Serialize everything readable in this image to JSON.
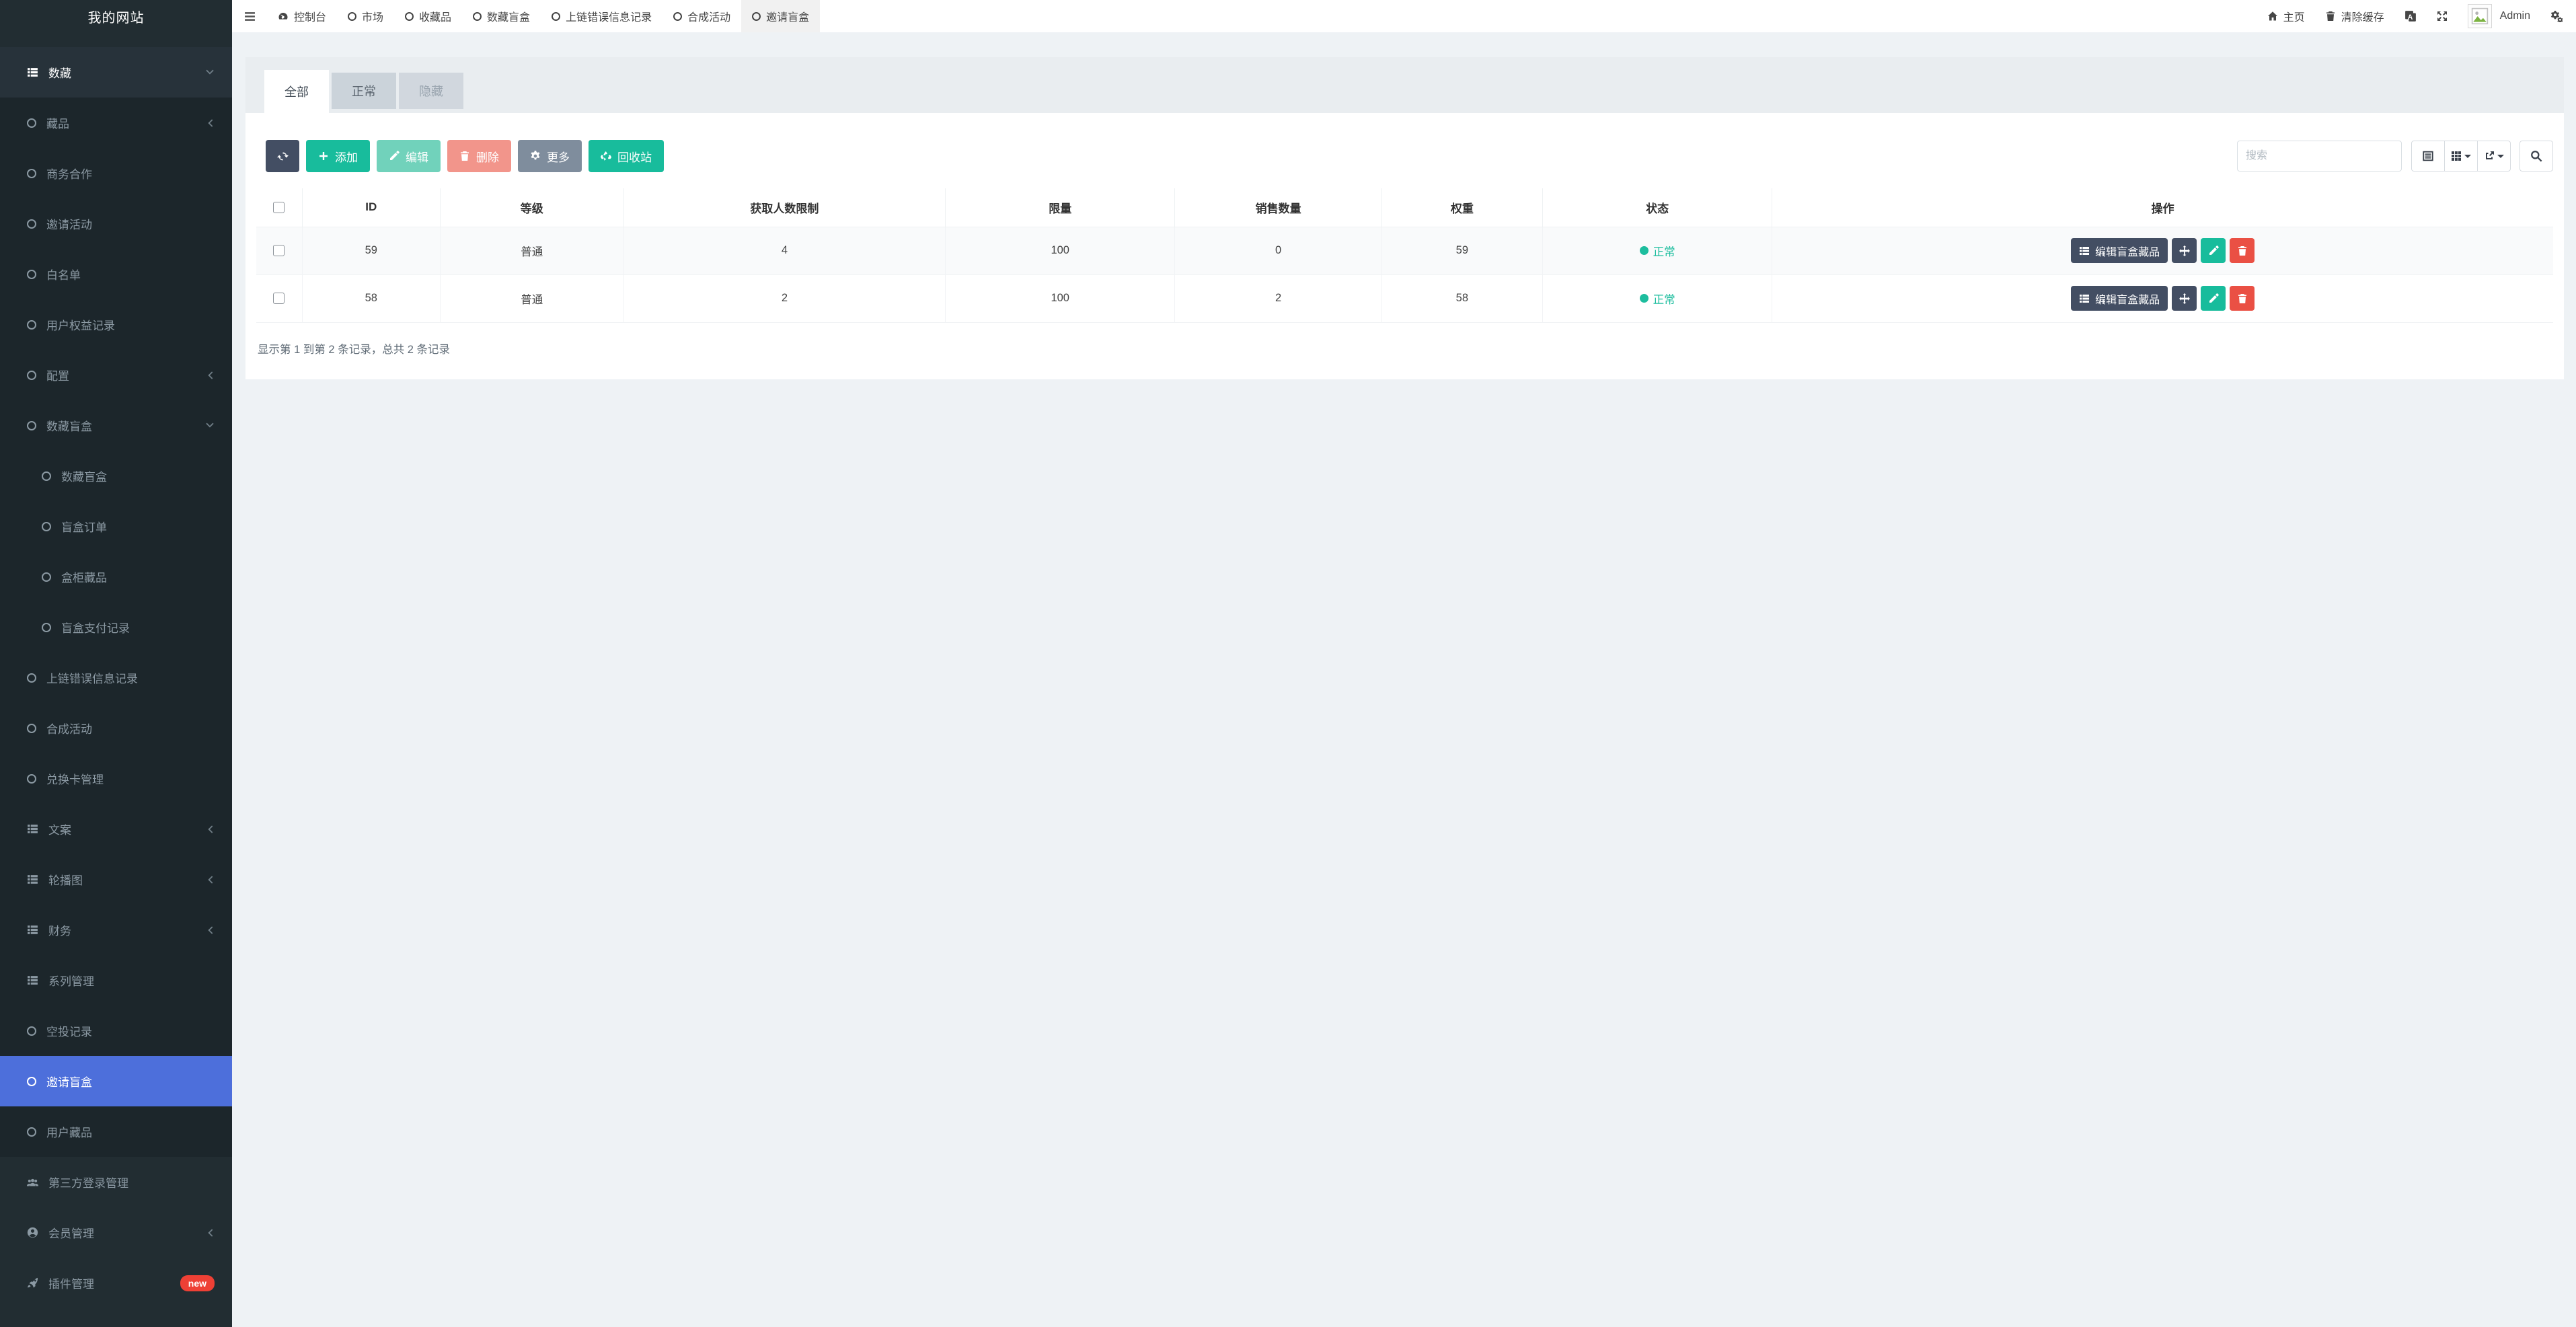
{
  "brand": {
    "title": "我的网站"
  },
  "topbar": {
    "nav": [
      {
        "label": "控制台",
        "icon": "dashboard-icon",
        "active": false
      },
      {
        "label": "市场",
        "icon": "circle-icon",
        "active": false
      },
      {
        "label": "收藏品",
        "icon": "circle-icon",
        "active": false
      },
      {
        "label": "数藏盲盒",
        "icon": "circle-icon",
        "active": false
      },
      {
        "label": "上链错误信息记录",
        "icon": "circle-icon",
        "active": false
      },
      {
        "label": "合成活动",
        "icon": "circle-icon",
        "active": false
      },
      {
        "label": "邀请盲盒",
        "icon": "circle-icon",
        "active": true
      }
    ],
    "right": {
      "home_label": "主页",
      "clear_cache_label": "清除缓存",
      "username": "Admin"
    }
  },
  "sidebar": {
    "items": [
      {
        "label": "数藏",
        "icon": "list-icon",
        "level": 0,
        "chevron": "down",
        "header": true
      },
      {
        "label": "藏品",
        "icon": "circle-icon",
        "level": 1,
        "chevron": "left"
      },
      {
        "label": "商务合作",
        "icon": "circle-icon",
        "level": 1
      },
      {
        "label": "邀请活动",
        "icon": "circle-icon",
        "level": 1
      },
      {
        "label": "白名单",
        "icon": "circle-icon",
        "level": 1
      },
      {
        "label": "用户权益记录",
        "icon": "circle-icon",
        "level": 1
      },
      {
        "label": "配置",
        "icon": "circle-icon",
        "level": 1,
        "chevron": "left"
      },
      {
        "label": "数藏盲盒",
        "icon": "circle-icon",
        "level": 1,
        "chevron": "down"
      },
      {
        "label": "数藏盲盒",
        "icon": "circle-icon",
        "level": 2
      },
      {
        "label": "盲盒订单",
        "icon": "circle-icon",
        "level": 2
      },
      {
        "label": "盒柜藏品",
        "icon": "circle-icon",
        "level": 2
      },
      {
        "label": "盲盒支付记录",
        "icon": "circle-icon",
        "level": 2
      },
      {
        "label": "上链错误信息记录",
        "icon": "circle-icon",
        "level": 1
      },
      {
        "label": "合成活动",
        "icon": "circle-icon",
        "level": 1
      },
      {
        "label": "兑换卡管理",
        "icon": "circle-icon",
        "level": 1
      },
      {
        "label": "文案",
        "icon": "list-icon",
        "level": 1,
        "chevron": "left"
      },
      {
        "label": "轮播图",
        "icon": "list-icon",
        "level": 1,
        "chevron": "left"
      },
      {
        "label": "财务",
        "icon": "list-icon",
        "level": 1,
        "chevron": "left"
      },
      {
        "label": "系列管理",
        "icon": "list-icon",
        "level": 1
      },
      {
        "label": "空投记录",
        "icon": "circle-icon",
        "level": 1
      },
      {
        "label": "邀请盲盒",
        "icon": "circle-icon",
        "level": 1,
        "active": true
      },
      {
        "label": "用户藏品",
        "icon": "circle-icon",
        "level": 1
      },
      {
        "label": "第三方登录管理",
        "icon": "users-icon",
        "level": 0
      },
      {
        "label": "会员管理",
        "icon": "user-icon",
        "level": 0,
        "chevron": "left"
      },
      {
        "label": "插件管理",
        "icon": "rocket-icon",
        "level": 0,
        "badge": "new"
      }
    ]
  },
  "content": {
    "tabs": [
      {
        "label": "全部",
        "state": "active"
      },
      {
        "label": "正常",
        "state": "normal"
      },
      {
        "label": "隐藏",
        "state": "muted"
      }
    ],
    "toolbar": {
      "add": "添加",
      "edit": "编辑",
      "delete": "删除",
      "more": "更多",
      "recycle": "回收站"
    },
    "search_placeholder": "搜索",
    "table": {
      "columns": [
        "ID",
        "等级",
        "获取人数限制",
        "限量",
        "销售数量",
        "权重",
        "状态",
        "操作"
      ],
      "action_button_label": "编辑盲盒藏品",
      "rows": [
        {
          "id": "59",
          "level": "普通",
          "acquire_limit": "4",
          "quota": "100",
          "sales": "0",
          "weight": "59",
          "status": "正常"
        },
        {
          "id": "58",
          "level": "普通",
          "acquire_limit": "2",
          "quota": "100",
          "sales": "2",
          "weight": "58",
          "status": "正常"
        }
      ]
    },
    "footer_summary": "显示第 1 到第 2 条记录，总共 2 条记录"
  },
  "colors": {
    "sidebar_bg": "#222d32",
    "submenu_bg": "#1c262b",
    "active_blue": "#4d6fdb",
    "accent_green": "#18bc9c",
    "primary_dark": "#434e63",
    "danger_red": "#ea5044",
    "muted_gray": "#7f8d9d",
    "badge_red": "#ee4035",
    "content_bg": "#eef2f5"
  }
}
